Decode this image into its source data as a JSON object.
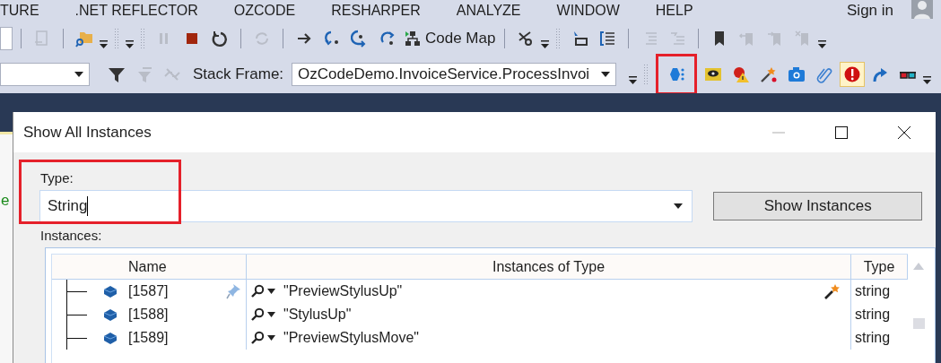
{
  "menu": [
    "TURE",
    ".NET REFLECTOR",
    "OZCODE",
    "RESHARPER",
    "ANALYZE",
    "WINDOW",
    "HELP"
  ],
  "sign_in": "Sign in",
  "toolbar_1": [
    {
      "kind": "device",
      "disabled": true
    },
    {
      "kind": "separator"
    },
    {
      "kind": "folder-search",
      "disabled": false
    },
    {
      "kind": "overflow"
    },
    {
      "kind": "grip"
    },
    {
      "kind": "overflow"
    },
    {
      "kind": "grip"
    },
    {
      "kind": "pause",
      "disabled": true
    },
    {
      "kind": "stop",
      "disabled": false
    },
    {
      "kind": "restart",
      "disabled": false
    },
    {
      "kind": "separator"
    },
    {
      "kind": "refresh",
      "disabled": true
    },
    {
      "kind": "separator"
    },
    {
      "kind": "arrow",
      "disabled": false
    },
    {
      "kind": "step-into",
      "disabled": false
    },
    {
      "kind": "step-down",
      "disabled": false
    },
    {
      "kind": "step-out",
      "disabled": false
    },
    {
      "kind": "codemap",
      "label": "Code Map",
      "disabled": false
    },
    {
      "kind": "separator"
    },
    {
      "kind": "scissors",
      "disabled": false
    },
    {
      "kind": "overflow"
    },
    {
      "kind": "grip"
    },
    {
      "kind": "cursor-box",
      "disabled": false
    },
    {
      "kind": "list-bracket",
      "disabled": false
    },
    {
      "kind": "separator"
    },
    {
      "kind": "indent",
      "disabled": true
    },
    {
      "kind": "outdent",
      "disabled": true
    },
    {
      "kind": "separator"
    },
    {
      "kind": "bookmark",
      "disabled": false
    },
    {
      "kind": "bookmark-prev",
      "disabled": true
    },
    {
      "kind": "bookmark-next",
      "disabled": true
    },
    {
      "kind": "bookmark-clear",
      "disabled": true
    },
    {
      "kind": "overflow"
    }
  ],
  "stack_frame": {
    "label": "Stack Frame:",
    "value": "OzCodeDemo.InvoiceService.ProcessInvoi"
  },
  "toolbar_2_left": [
    {
      "kind": "filter",
      "disabled": false
    },
    {
      "kind": "filter-clear",
      "disabled": true
    },
    {
      "kind": "link-off",
      "disabled": true
    }
  ],
  "toolbar_2_right": [
    {
      "kind": "instances",
      "on": false,
      "highlighted": true
    },
    {
      "kind": "eye",
      "on": false
    },
    {
      "kind": "bell-warning",
      "on": false
    },
    {
      "kind": "wand",
      "on": false
    },
    {
      "kind": "camera",
      "on": false
    },
    {
      "kind": "paperclip",
      "on": false
    },
    {
      "kind": "exclamation",
      "on": true
    },
    {
      "kind": "share-arrow",
      "on": false
    },
    {
      "kind": "glasses",
      "on": false
    }
  ],
  "editor_fragment": "e",
  "dialog": {
    "title": "Show All Instances",
    "controls": [
      {
        "kind": "minimize",
        "disabled": true
      },
      {
        "kind": "maximize",
        "disabled": false
      },
      {
        "kind": "close",
        "disabled": false
      }
    ],
    "type_label": "Type:",
    "type_value": "String",
    "type_highlighted": true,
    "show_button": "Show Instances",
    "instances_label": "Instances:",
    "columns": [
      "Name",
      "Instances of Type",
      "Type"
    ],
    "rows": [
      {
        "name": "[1587]",
        "value": "\"PreviewStylusUp\"",
        "type": "string",
        "pinned": true,
        "magic_wand": true
      },
      {
        "name": "[1588]",
        "value": "\"StylusUp\"",
        "type": "string",
        "pinned": false,
        "magic_wand": false
      },
      {
        "name": "[1589]",
        "value": "\"PreviewStylusMove\"",
        "type": "string",
        "pinned": false,
        "magic_wand": false
      }
    ]
  }
}
